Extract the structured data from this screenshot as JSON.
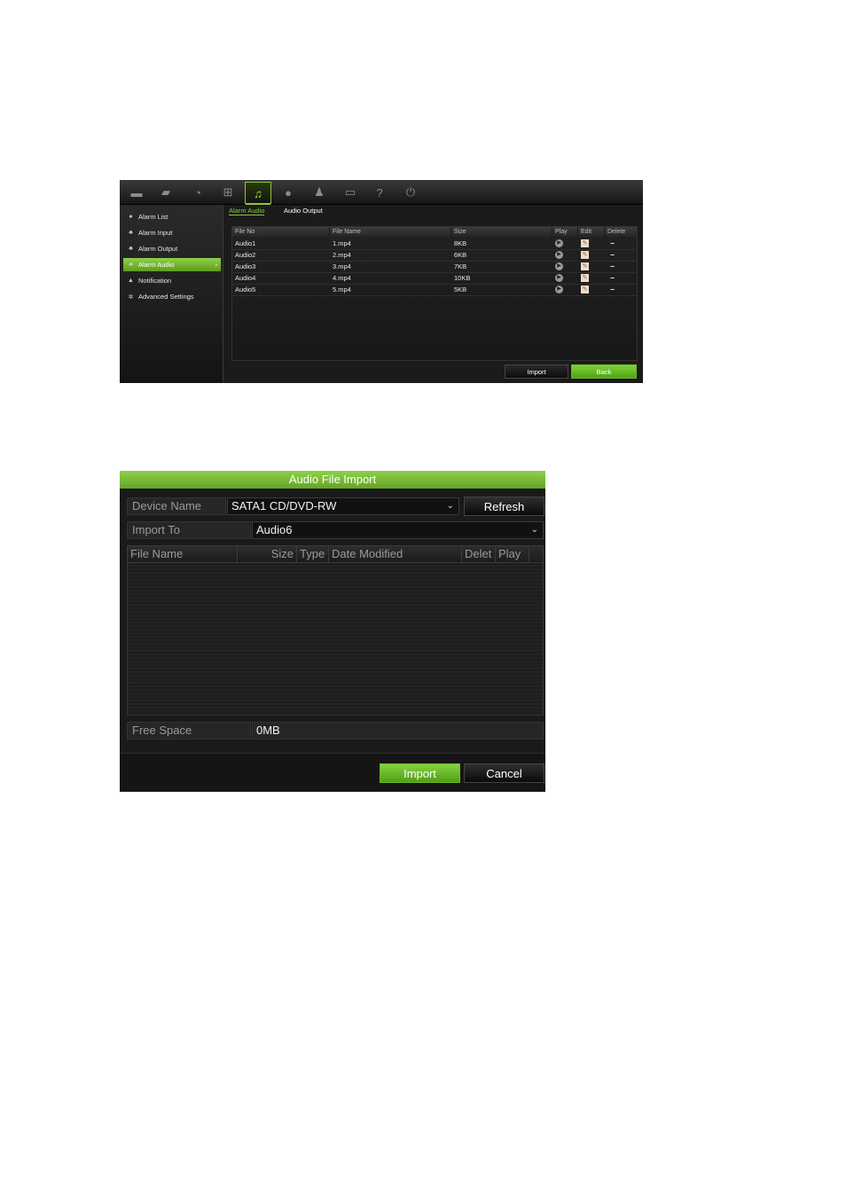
{
  "screen1": {
    "toolbar_icons": [
      "monitor-icon",
      "camera-icon",
      "schedule-icon",
      "network-icon",
      "alarm-bell-icon",
      "disk-icon",
      "user-icon",
      "device-icon",
      "help-icon",
      "power-icon"
    ],
    "sidebar": {
      "items": [
        {
          "label": "Alarm List",
          "icon": "alarm-list-icon"
        },
        {
          "label": "Alarm Input",
          "icon": "alarm-input-icon"
        },
        {
          "label": "Alarm Output",
          "icon": "alarm-output-icon"
        },
        {
          "label": "Alarm Audio",
          "icon": "alarm-audio-icon",
          "selected": true
        },
        {
          "label": "Notification",
          "icon": "notification-icon"
        },
        {
          "label": "Advanced Settings",
          "icon": "advanced-settings-icon"
        }
      ]
    },
    "tabs": [
      {
        "label": "Alarm Audio",
        "selected": true
      },
      {
        "label": "Audio Output",
        "selected": false
      }
    ],
    "table": {
      "columns": [
        "File No",
        "File Name",
        "Size",
        "Play",
        "Edit",
        "Delete"
      ],
      "rows": [
        {
          "file_no": "Audio1",
          "file_name": "1.mp4",
          "size": "8KB"
        },
        {
          "file_no": "Audio2",
          "file_name": "2.mp4",
          "size": "6KB"
        },
        {
          "file_no": "Audio3",
          "file_name": "3.mp4",
          "size": "7KB"
        },
        {
          "file_no": "Audio4",
          "file_name": "4.mp4",
          "size": "10KB"
        },
        {
          "file_no": "Audio5",
          "file_name": "5.mp4",
          "size": "5KB"
        }
      ]
    },
    "buttons": {
      "import": "Import",
      "back": "Back"
    },
    "accent_color": "#8cc63f"
  },
  "screen2": {
    "title": "Audio File Import",
    "device_name_label": "Device Name",
    "device_name_value": "SATA1 CD/DVD-RW",
    "refresh": "Refresh",
    "import_to_label": "Import To",
    "import_to_value": "Audio6",
    "file_columns": [
      "File Name",
      "Size",
      "Type",
      "Date Modified",
      "Delet",
      "Play"
    ],
    "free_space_label": "Free Space",
    "free_space_value": "0MB",
    "buttons": {
      "import": "Import",
      "cancel": "Cancel"
    }
  }
}
